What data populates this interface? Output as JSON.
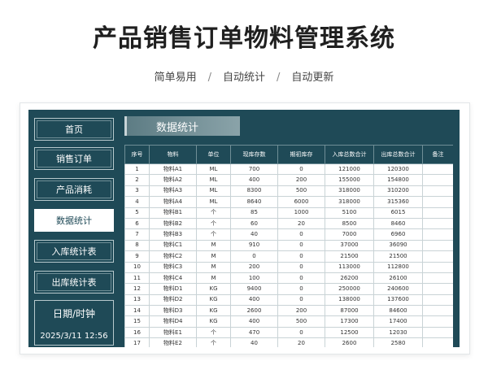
{
  "page": {
    "title": "产品销售订单物料管理系统",
    "features": [
      "简单易用",
      "自动统计",
      "自动更新"
    ]
  },
  "nav": {
    "items": [
      {
        "label": "首页",
        "active": false
      },
      {
        "label": "销售订单",
        "active": false
      },
      {
        "label": "产品消耗",
        "active": false
      },
      {
        "label": "数据统计",
        "active": true
      },
      {
        "label": "入库统计表",
        "active": false
      },
      {
        "label": "出库统计表",
        "active": false
      }
    ],
    "datetime_label": "日期/时钟",
    "datetime_value": "2025/3/11  12:56"
  },
  "section": {
    "title": "数据统计"
  },
  "table": {
    "headers": [
      "序号",
      "物料",
      "单位",
      "现库存数",
      "期初库存",
      "入库总数合计",
      "出库总数合计",
      "备注"
    ],
    "rows": [
      [
        "1",
        "物料A1",
        "ML",
        "700",
        "0",
        "121000",
        "120300",
        ""
      ],
      [
        "2",
        "物料A2",
        "ML",
        "400",
        "200",
        "155000",
        "154800",
        ""
      ],
      [
        "3",
        "物料A3",
        "ML",
        "8300",
        "500",
        "318000",
        "310200",
        ""
      ],
      [
        "4",
        "物料A4",
        "ML",
        "8640",
        "6000",
        "318000",
        "315360",
        ""
      ],
      [
        "5",
        "物料B1",
        "个",
        "85",
        "1000",
        "5100",
        "6015",
        ""
      ],
      [
        "6",
        "物料B2",
        "个",
        "60",
        "20",
        "8500",
        "8460",
        ""
      ],
      [
        "7",
        "物料B3",
        "个",
        "40",
        "0",
        "7000",
        "6960",
        ""
      ],
      [
        "8",
        "物料C1",
        "M",
        "910",
        "0",
        "37000",
        "36090",
        ""
      ],
      [
        "9",
        "物料C2",
        "M",
        "0",
        "0",
        "21500",
        "21500",
        ""
      ],
      [
        "10",
        "物料C3",
        "M",
        "200",
        "0",
        "113000",
        "112800",
        ""
      ],
      [
        "11",
        "物料C4",
        "M",
        "100",
        "0",
        "26200",
        "26100",
        ""
      ],
      [
        "12",
        "物料D1",
        "KG",
        "9400",
        "0",
        "250000",
        "240600",
        ""
      ],
      [
        "13",
        "物料D2",
        "KG",
        "400",
        "0",
        "138000",
        "137600",
        ""
      ],
      [
        "14",
        "物料D3",
        "KG",
        "2600",
        "200",
        "87000",
        "84600",
        ""
      ],
      [
        "15",
        "物料D4",
        "KG",
        "400",
        "500",
        "17300",
        "17400",
        ""
      ],
      [
        "16",
        "物料E1",
        "个",
        "470",
        "0",
        "12500",
        "12030",
        ""
      ],
      [
        "17",
        "物料E2",
        "个",
        "40",
        "20",
        "2600",
        "2580",
        ""
      ]
    ]
  }
}
